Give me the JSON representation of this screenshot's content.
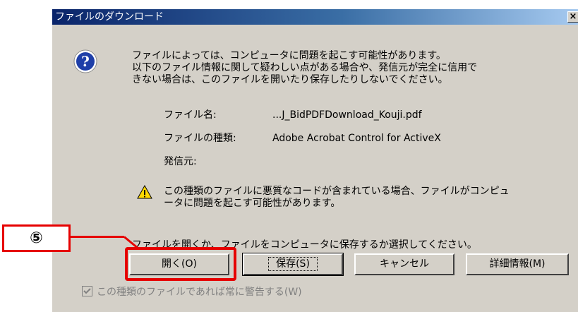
{
  "window": {
    "title": "ファイルのダウンロード",
    "close_label": "×"
  },
  "message": {
    "lines": [
      "ファイルによっては、コンピュータに問題を起こす可能性があります。",
      "以下のファイル情報に関して疑わしい点がある場合や、発信元が完全に信用で",
      "きない場合は、このファイルを開いたり保存したりしないでください。"
    ]
  },
  "file_info": {
    "name_label": "ファイル名:",
    "name_value": "...J_BidPDFDownload_Kouji.pdf",
    "type_label": "ファイルの種類:",
    "type_value": "Adobe Acrobat Control for ActiveX",
    "source_label": "発信元:",
    "source_value": ""
  },
  "warning": {
    "lines": [
      "この種類のファイルに悪質なコードが含まれている場合、ファイルがコンピュ",
      "ータに問題を起こす可能性があります。"
    ]
  },
  "prompt": "ファイルを開くか、ファイルをコンピュータに保存するか選択してください。",
  "buttons": {
    "open": "開く(O)",
    "save": "保存(S)",
    "cancel": "キャンセル",
    "details": "詳細情報(M)"
  },
  "checkbox": {
    "label": "この種類のファイルであれば常に警告する(W)",
    "checked": true
  },
  "annotation": {
    "step_label": "⑤",
    "color": "#e60000"
  },
  "icons": {
    "question": "question-icon",
    "warning": "warning-icon"
  },
  "colors": {
    "dialog_bg": "#d4d0c8",
    "titlebar_start": "#0a246a",
    "titlebar_end": "#a6caf0",
    "highlight": "#e60000"
  }
}
